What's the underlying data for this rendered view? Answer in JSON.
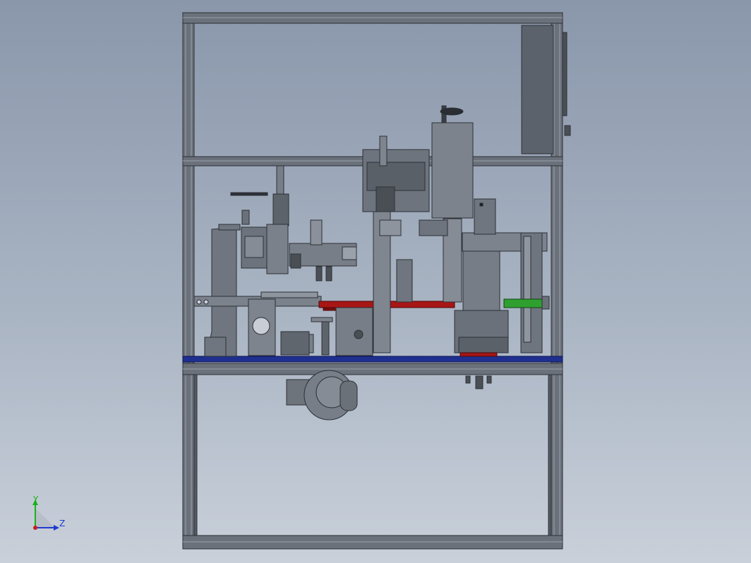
{
  "triad": {
    "y_label": "Y",
    "z_label": "Z",
    "y_color": "#19b219",
    "z_color": "#1f3ccf",
    "origin_color": "#c81e1e"
  },
  "colors": {
    "frame": "#5f6670",
    "frame_edge": "#2d3036",
    "frame_light": "#8d949d",
    "plate_blue": "#1f2f8f",
    "red_bar": "#a81616",
    "green_rod": "#2fa02f",
    "machine": "#7d838b",
    "machine_dark": "#4a4f56"
  }
}
